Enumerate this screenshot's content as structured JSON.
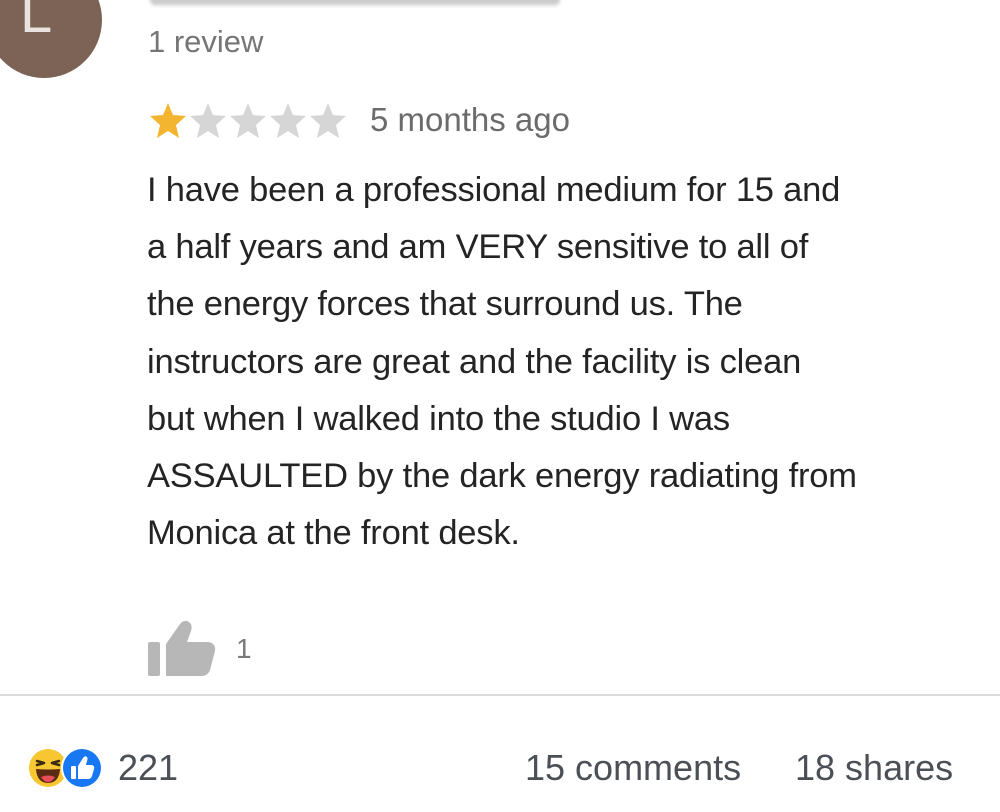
{
  "review": {
    "reviewer_initial": "L",
    "review_count": "1 review",
    "rating": {
      "value": 1,
      "max": 5
    },
    "time_ago": "5 months ago",
    "text_lines": [
      "I have been a professional medium for 15 and",
      "a half years and am VERY sensitive to all of",
      "the energy forces that surround us. The",
      "instructors are great and the facility is clean",
      "but when I walked into the studio I was",
      "ASSAULTED by the dark energy radiating from",
      "Monica at the front desk."
    ],
    "like_count": "1",
    "colors": {
      "star_filled": "#f3b530",
      "star_empty": "#d6d6d6",
      "avatar_bg": "#7d6356"
    },
    "icons": {
      "like": "thumbs-up-icon",
      "star": "star-icon"
    }
  },
  "post_footer": {
    "reaction_icons": [
      "haha-reaction-icon",
      "like-reaction-icon"
    ],
    "reaction_count": "221",
    "comments": "15 comments",
    "shares": "18 shares",
    "colors": {
      "like_blue": "#1877f2",
      "haha_yellow": "#f7c631",
      "text": "#4b4f56"
    }
  }
}
